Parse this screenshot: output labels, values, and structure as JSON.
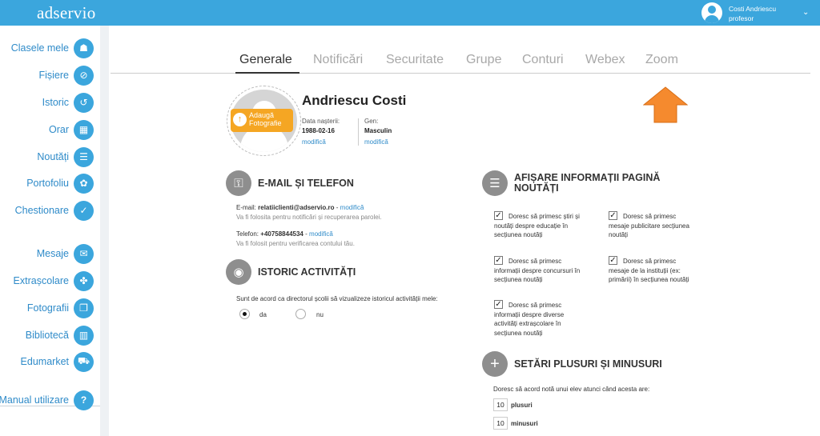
{
  "topbar": {
    "logo": "adservio",
    "user_name": "Costi Andriescu",
    "user_role": "profesor"
  },
  "sidebar": {
    "items": [
      {
        "label": "Clasele mele",
        "icon": "people-icon"
      },
      {
        "label": "Fișiere",
        "icon": "paperclip-icon"
      },
      {
        "label": "Istoric",
        "icon": "history-icon"
      },
      {
        "label": "Orar",
        "icon": "calendar-icon"
      },
      {
        "label": "Noutăți",
        "icon": "news-icon"
      },
      {
        "label": "Portofoliu",
        "icon": "portfolio-icon"
      },
      {
        "label": "Chestionare",
        "icon": "survey-icon"
      },
      {
        "label": "Mesaje",
        "icon": "mail-icon"
      },
      {
        "label": "Extrașcolare",
        "icon": "activity-icon"
      },
      {
        "label": "Fotografii",
        "icon": "photo-icon"
      },
      {
        "label": "Bibliotecă",
        "icon": "library-icon"
      },
      {
        "label": "Edumarket",
        "icon": "cart-icon"
      }
    ],
    "manual": {
      "label": "Manual utilizare",
      "icon": "help-icon"
    }
  },
  "tabs": [
    "Generale",
    "Notificări",
    "Securitate",
    "Grupe",
    "Conturi",
    "Webex",
    "Zoom"
  ],
  "active_tab": "Generale",
  "profile": {
    "add_photo": "Adaugă Fotografie",
    "name": "Andriescu Costi",
    "birth_label": "Data nașterii:",
    "birth_value": "1988-02-16",
    "gender_label": "Gen:",
    "gender_value": "Masculin",
    "edit_link": "modifică"
  },
  "contact": {
    "title": "E-MAIL ȘI TELEFON",
    "email_label": "E-mail:",
    "email_value": "relatiiclienti@adservio.ro",
    "email_note": "Va fi folosita pentru notificări și recuperarea parolei.",
    "phone_label": "Telefon:",
    "phone_value": "+40758844534",
    "phone_note": "Va fi folosit pentru verificarea contului tău.",
    "edit_link": "modifică",
    "sep": "-"
  },
  "history": {
    "title": "ISTORIC ACTIVITĂȚI",
    "text": "Sunt de acord ca directorul școlii să vizualizeze istoricul activității mele:",
    "yes": "da",
    "no": "nu",
    "selected": "da"
  },
  "news": {
    "title": "AFIȘARE INFORMAȚII PAGINĂ NOUTĂȚI",
    "options": [
      {
        "first": "Doresc să primesc știri și",
        "rest": "noutăți despre educație în secțiunea noutăți",
        "checked": true
      },
      {
        "first": "Doresc să primesc",
        "rest": "mesaje publicitare secțiunea noutăți",
        "checked": true
      },
      {
        "first": "Doresc să primesc",
        "rest": "informații despre concursuri în secțiunea noutăți",
        "checked": true
      },
      {
        "first": "Doresc să primesc",
        "rest": "mesaje de la instituții (ex: primării) în secțiunea noutăți",
        "checked": true
      },
      {
        "first": "Doresc să primesc",
        "rest": "informații despre diverse activități extrașcolare în secțiunea noutăți",
        "checked": true
      }
    ]
  },
  "plusminus": {
    "title": "SETĂRI PLUSURI ȘI MINUSURI",
    "text": "Doresc să acord notă unui elev atunci când acesta are:",
    "plus_value": "10",
    "plus_label": "plusuri",
    "minus_value": "10",
    "minus_label": "minusuri"
  },
  "colors": {
    "brand": "#3ba6dd",
    "accent": "#f5a623",
    "arrow": "#f58a2e"
  }
}
